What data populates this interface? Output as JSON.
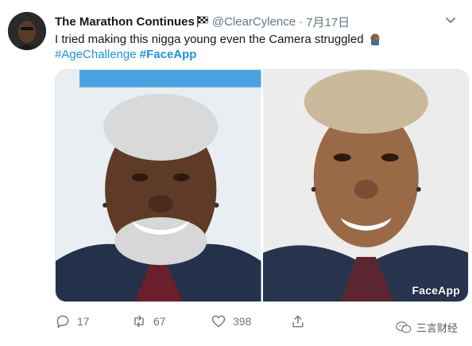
{
  "tweet": {
    "display_name": "The Marathon Continues",
    "handle": "@ClearCylence",
    "separator": "·",
    "date": "7月17日",
    "text": "I tried making this nigga young even the Camera struggled",
    "hashtags": [
      "#AgeChallenge",
      "#FaceApp"
    ],
    "media": {
      "watermark": "FaceApp"
    },
    "actions": {
      "reply_count": "17",
      "retweet_count": "67",
      "like_count": "398"
    }
  },
  "overlay": {
    "wechat_label": "三言财经"
  },
  "colors": {
    "link": "#1b95e0",
    "muted": "#657786",
    "text": "#14171a"
  }
}
